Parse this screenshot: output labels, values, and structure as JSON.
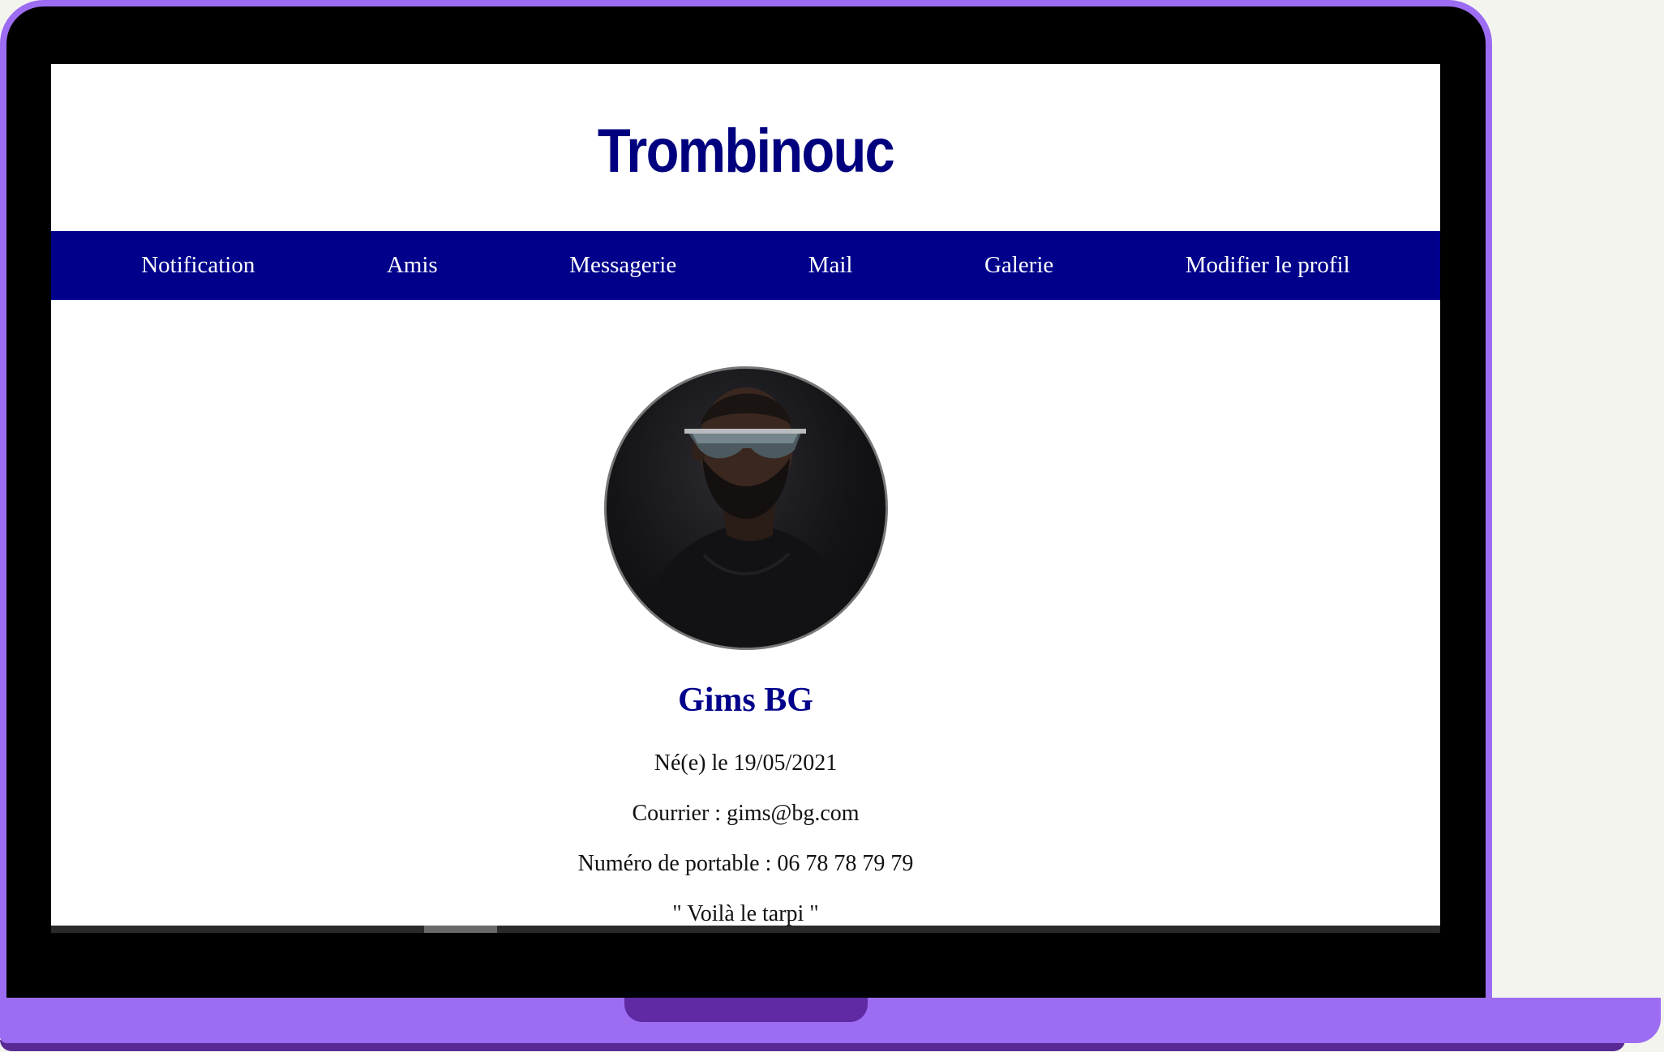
{
  "site": {
    "title": "Trombinouc"
  },
  "nav": {
    "items": [
      {
        "label": "Notification"
      },
      {
        "label": "Amis"
      },
      {
        "label": "Messagerie"
      },
      {
        "label": "Mail"
      },
      {
        "label": "Galerie"
      },
      {
        "label": "Modifier le profil"
      }
    ]
  },
  "profile": {
    "name": "Gims BG",
    "birth": "Né(e) le 19/05/2021",
    "email": "Courrier : gims@bg.com",
    "phone": "Numéro de portable : 06 78 78 79 79",
    "quote": "\" Voilà le tarpi \""
  },
  "colors": {
    "accent": "#00008b",
    "frame": "#9c6cf2",
    "frame_dark": "#5f2aa3"
  }
}
